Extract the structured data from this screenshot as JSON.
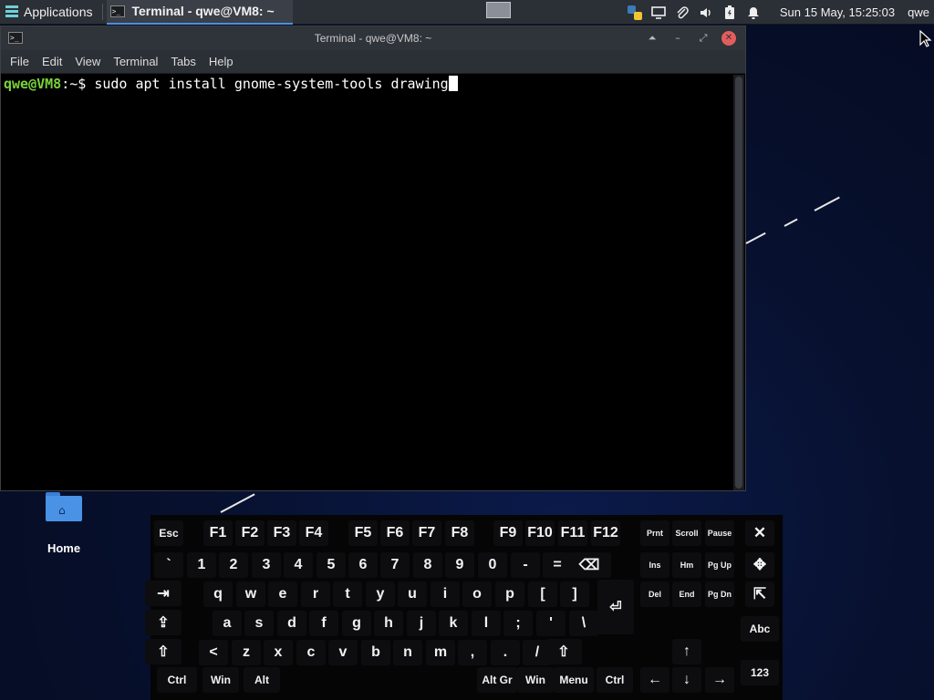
{
  "top_panel": {
    "applications_label": "Applications",
    "task_title": "Terminal - qwe@VM8: ~",
    "clock": "Sun 15 May, 15:25:03",
    "user": "qwe"
  },
  "terminal": {
    "title": "Terminal - qwe@VM8: ~",
    "menu": [
      "File",
      "Edit",
      "View",
      "Terminal",
      "Tabs",
      "Help"
    ],
    "prompt_user": "qwe@VM8",
    "prompt_rest": ":~$ ",
    "command": "sudo apt install gnome-system-tools drawing"
  },
  "desktop": {
    "home_label": "Home"
  },
  "keyboard": {
    "keys": [
      {
        "label": "Esc"
      },
      {
        "label": "F1"
      },
      {
        "label": "F2"
      },
      {
        "label": "F3"
      },
      {
        "label": "F4"
      },
      {
        "label": "F5"
      },
      {
        "label": "F6"
      },
      {
        "label": "F7"
      },
      {
        "label": "F8"
      },
      {
        "label": "F9"
      },
      {
        "label": "F10"
      },
      {
        "label": "F11"
      },
      {
        "label": "F12"
      },
      {
        "label": "Prnt"
      },
      {
        "label": "Scroll"
      },
      {
        "label": "Pause"
      },
      {
        "label": "✕"
      },
      {
        "label": "`"
      },
      {
        "label": "1"
      },
      {
        "label": "2"
      },
      {
        "label": "3"
      },
      {
        "label": "4"
      },
      {
        "label": "5"
      },
      {
        "label": "6"
      },
      {
        "label": "7"
      },
      {
        "label": "8"
      },
      {
        "label": "9"
      },
      {
        "label": "0"
      },
      {
        "label": "-"
      },
      {
        "label": "="
      },
      {
        "label": "⌫"
      },
      {
        "label": "Ins"
      },
      {
        "label": "Hm"
      },
      {
        "label": "Pg Up"
      },
      {
        "label": "✥"
      },
      {
        "label": "⇥"
      },
      {
        "label": "q"
      },
      {
        "label": "w"
      },
      {
        "label": "e"
      },
      {
        "label": "r"
      },
      {
        "label": "t"
      },
      {
        "label": "y"
      },
      {
        "label": "u"
      },
      {
        "label": "i"
      },
      {
        "label": "o"
      },
      {
        "label": "p"
      },
      {
        "label": "["
      },
      {
        "label": "]"
      },
      {
        "label": "⏎"
      },
      {
        "label": "Del"
      },
      {
        "label": "End"
      },
      {
        "label": "Pg Dn"
      },
      {
        "label": "⇱"
      },
      {
        "label": "⇪"
      },
      {
        "label": "a"
      },
      {
        "label": "s"
      },
      {
        "label": "d"
      },
      {
        "label": "f"
      },
      {
        "label": "g"
      },
      {
        "label": "h"
      },
      {
        "label": "j"
      },
      {
        "label": "k"
      },
      {
        "label": "l"
      },
      {
        "label": ";"
      },
      {
        "label": "'"
      },
      {
        "label": "\\"
      },
      {
        "label": "Abc"
      },
      {
        "label": "⇧"
      },
      {
        "label": "<"
      },
      {
        "label": "z"
      },
      {
        "label": "x"
      },
      {
        "label": "c"
      },
      {
        "label": "v"
      },
      {
        "label": "b"
      },
      {
        "label": "n"
      },
      {
        "label": "m"
      },
      {
        "label": ","
      },
      {
        "label": "."
      },
      {
        "label": "/"
      },
      {
        "label": "⇧"
      },
      {
        "label": "↑"
      },
      {
        "label": "Ctrl"
      },
      {
        "label": "Win"
      },
      {
        "label": "Alt"
      },
      {
        "label": "Alt Gr"
      },
      {
        "label": "Win"
      },
      {
        "label": "Menu"
      },
      {
        "label": "Ctrl"
      },
      {
        "label": "←"
      },
      {
        "label": "↓"
      },
      {
        "label": "→"
      },
      {
        "label": "123"
      }
    ]
  }
}
